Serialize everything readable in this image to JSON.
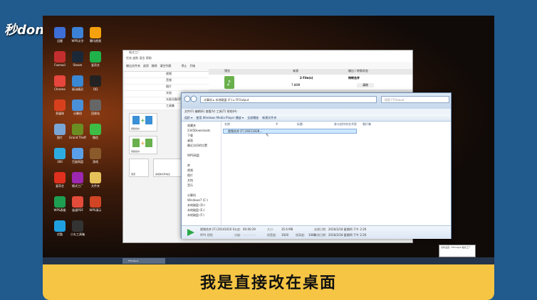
{
  "logo": {
    "text": "秒dong视频"
  },
  "caption": "我是直接改在桌面",
  "desktop_icons": [
    {
      "label": "迅雷",
      "color": "#3d6fd6"
    },
    {
      "label": "WPS文字",
      "color": "#3b82d6"
    },
    {
      "label": "腾讯视频",
      "color": "#f5a10d"
    },
    {
      "label": "Foxmail",
      "color": "#c52e2e"
    },
    {
      "label": "Steam",
      "color": "#1b2838"
    },
    {
      "label": "爱奇艺",
      "color": "#20b24a"
    },
    {
      "label": "Chrome",
      "color": "#e8453c"
    },
    {
      "label": "驱动精灵",
      "color": "#3a87d4"
    },
    {
      "label": "QQ",
      "color": "#222"
    },
    {
      "label": "多媒体",
      "color": "#d8401d"
    },
    {
      "label": "计算机",
      "color": "#4a90d9"
    },
    {
      "label": "回收站",
      "color": "#666"
    },
    {
      "label": "图片",
      "color": "#7aa6d6"
    },
    {
      "label": "Grand Theft Auto V",
      "color": "#6b8e23"
    },
    {
      "label": "微信",
      "color": "#3dbd46"
    },
    {
      "label": "360",
      "color": "#2dabe0"
    },
    {
      "label": "百度网盘",
      "color": "#5aa0e8"
    },
    {
      "label": "游戏",
      "color": "#8b5a2b"
    },
    {
      "label": "爱奇艺",
      "color": "#e0301e"
    },
    {
      "label": "格式工厂",
      "color": "#9c27b0"
    },
    {
      "label": "文件夹",
      "color": "#e6c15a"
    },
    {
      "label": "WPS表格",
      "color": "#1e9e51"
    },
    {
      "label": "极速PDF",
      "color": "#e34b3a"
    },
    {
      "label": "WPS演示",
      "color": "#d14424"
    },
    {
      "label": "优酷",
      "color": "#1fa0e0"
    },
    {
      "label": "小丸工具箱",
      "color": "#333"
    }
  ],
  "win1": {
    "title": "格式工厂",
    "menu": "任务  皮肤  语言  帮助",
    "toolbar": [
      "输出文件夹",
      "选项",
      "移除",
      "清空列表",
      "停止",
      "开始"
    ],
    "nav": [
      "视频",
      "音频",
      "图片",
      "文档",
      "光驱设备\\DVD\\CD\\ISO",
      "工具集"
    ],
    "tiles": [
      "视频合并",
      "音频合并",
      "混流",
      "多媒体文件信息"
    ],
    "header": {
      "preview": "预览",
      "source": "来源",
      "state": "输出 / 转换状态"
    },
    "row": {
      "count": "2 File(s)",
      "size": "7.86M",
      "status": "待转合并",
      "action": "清除"
    },
    "status_path": "F:\\FFOutput"
  },
  "win2": {
    "address": "计算机 ▸ 本地磁盘 (F:) ▸ FFOutput",
    "search_placeholder": "搜索 FFOutput",
    "menu": "文件(F)  编辑(E)  查看(V)  工具(T)  帮助(H)",
    "commands": [
      "组织 ▾",
      "使用 Windows Media Player 播放 ▾",
      "全部播放",
      "新建文件夹"
    ],
    "tree": [
      "收藏夹",
      "2345Downloads",
      "下载",
      "桌面",
      "最近访问的位置",
      "",
      "WPS网盘",
      "",
      "库",
      "视频",
      "图片",
      "文档",
      "音乐",
      "",
      "计算机",
      "Windows7 (C:)",
      "本地磁盘 (D:)",
      "本地磁盘 (E:)",
      "本地磁盘 (F:)"
    ],
    "columns": [
      "名称",
      "#",
      "标题",
      "参与创作的艺术家",
      "唱片集"
    ],
    "file": "视频合并 [F] 20211028...",
    "details": {
      "name": "视频合并 [F] 20141010 0",
      "type": "MP4 视频",
      "length_label": "长度:",
      "length": "00:00:29",
      "size_label": "大小:",
      "size": "35.6 MB",
      "rating_label": "分级:",
      "bitrate_label": "帧宽度:",
      "bitrate": "1920",
      "dims_label": "帧高度:",
      "dims": "1080",
      "created_label": "创建日期:",
      "created": "2016/2/18 星期四 下午 2:20",
      "modified_label": "修改日期:",
      "modified": "2016/2/18 星期四 下午 2:20"
    }
  },
  "taskbar": {
    "button": "FFOutput"
  },
  "tray_popup": "文件设置...FFOutput 格式工厂"
}
